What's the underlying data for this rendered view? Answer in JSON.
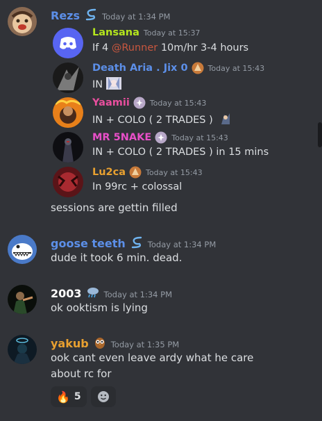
{
  "messages": [
    {
      "author": "Rezs",
      "author_color": "#5c8fe8",
      "timestamp": "Today at 1:34 PM",
      "embed": [
        {
          "author": "Lansana",
          "color": "#b5e61d",
          "timestamp": "Today at 15:37",
          "text_before": "If 4 ",
          "mention": "@Runner",
          "text_after": " 10m/hr 3-4 hours"
        },
        {
          "author": "Death Aria . Jix 0",
          "color": "#5c8fe8",
          "timestamp": "Today at 15:43",
          "text": "IN"
        },
        {
          "author": "Yaamii",
          "color": "#e84f9e",
          "timestamp": "Today at 15:43",
          "text": "IN + COLO ( 2 TRADES )"
        },
        {
          "author": "MR 5NAKE",
          "color": "#e84fc8",
          "timestamp": "Today at 15:43",
          "text": "IN + COLO ( 2 TRADES ) in 15 mins"
        },
        {
          "author": "Lu2ca",
          "color": "#e8a030",
          "timestamp": "Today at 15:43",
          "text": "In 99rc + colossal"
        }
      ],
      "text": "sessions are gettin filled"
    },
    {
      "author": "goose teeth",
      "author_color": "#5c8fe8",
      "timestamp": "Today at 1:34 PM",
      "text": "dude it took 6 min. dead."
    },
    {
      "author": "2003",
      "author_color": "#ffffff",
      "timestamp": "Today at 1:34 PM",
      "text": "ok ooktism is lying"
    },
    {
      "author": "yakub",
      "author_color": "#e8a030",
      "timestamp": "Today at 1:35 PM",
      "text_line1": "ook cant even leave ardy what he care",
      "text_line2": "about rc for"
    }
  ],
  "reactions": [
    {
      "emoji": "🔥",
      "count": "5"
    }
  ],
  "icons": {
    "nitro_badge": "nitro-s-icon",
    "owl_badge": "owl-icon",
    "cloud_badge": "raincloud-icon",
    "add_reaction": "smile-icon"
  }
}
